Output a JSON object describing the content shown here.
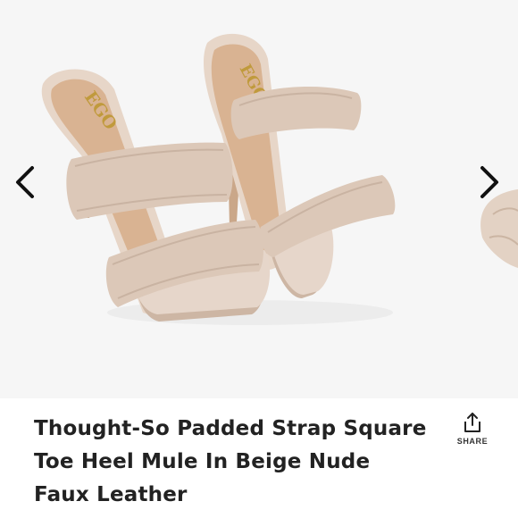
{
  "product": {
    "title": "Thought-So Padded Strap Square Toe Heel Mule In Beige Nude Faux Leather",
    "image": {
      "brand_mark": "EGO",
      "colors": {
        "background": "#f6f6f6",
        "shoe_beige": "#dcc8b8",
        "insole": "#d9b392",
        "heel": "#caa789",
        "logo_gold": "#c09a3c"
      }
    }
  },
  "gallery": {
    "prev_icon": "chevron-left-icon",
    "next_icon": "chevron-right-icon"
  },
  "share": {
    "label": "SHARE",
    "icon": "share-icon"
  }
}
